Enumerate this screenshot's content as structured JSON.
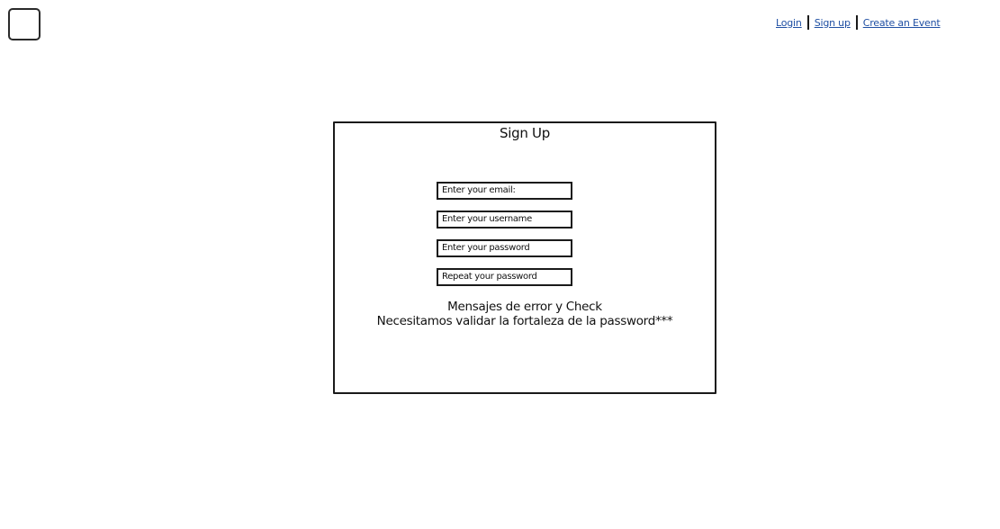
{
  "header": {
    "logo_icon": "square-logo-icon",
    "nav": [
      {
        "label": "Login"
      },
      {
        "label": "Sign up"
      },
      {
        "label": "Create an Event"
      }
    ],
    "link_color": "#1f4fa3"
  },
  "signup": {
    "title": "Sign Up",
    "fields": {
      "email": {
        "placeholder": "Enter your email:"
      },
      "username": {
        "placeholder": "Enter your username"
      },
      "password": {
        "placeholder": "Enter your password"
      },
      "repeat_password": {
        "placeholder": "Repeat your password"
      }
    },
    "message_line1": "Mensajes de error y Check",
    "message_line2": "Necesitamos validar la fortaleza de la password***"
  }
}
